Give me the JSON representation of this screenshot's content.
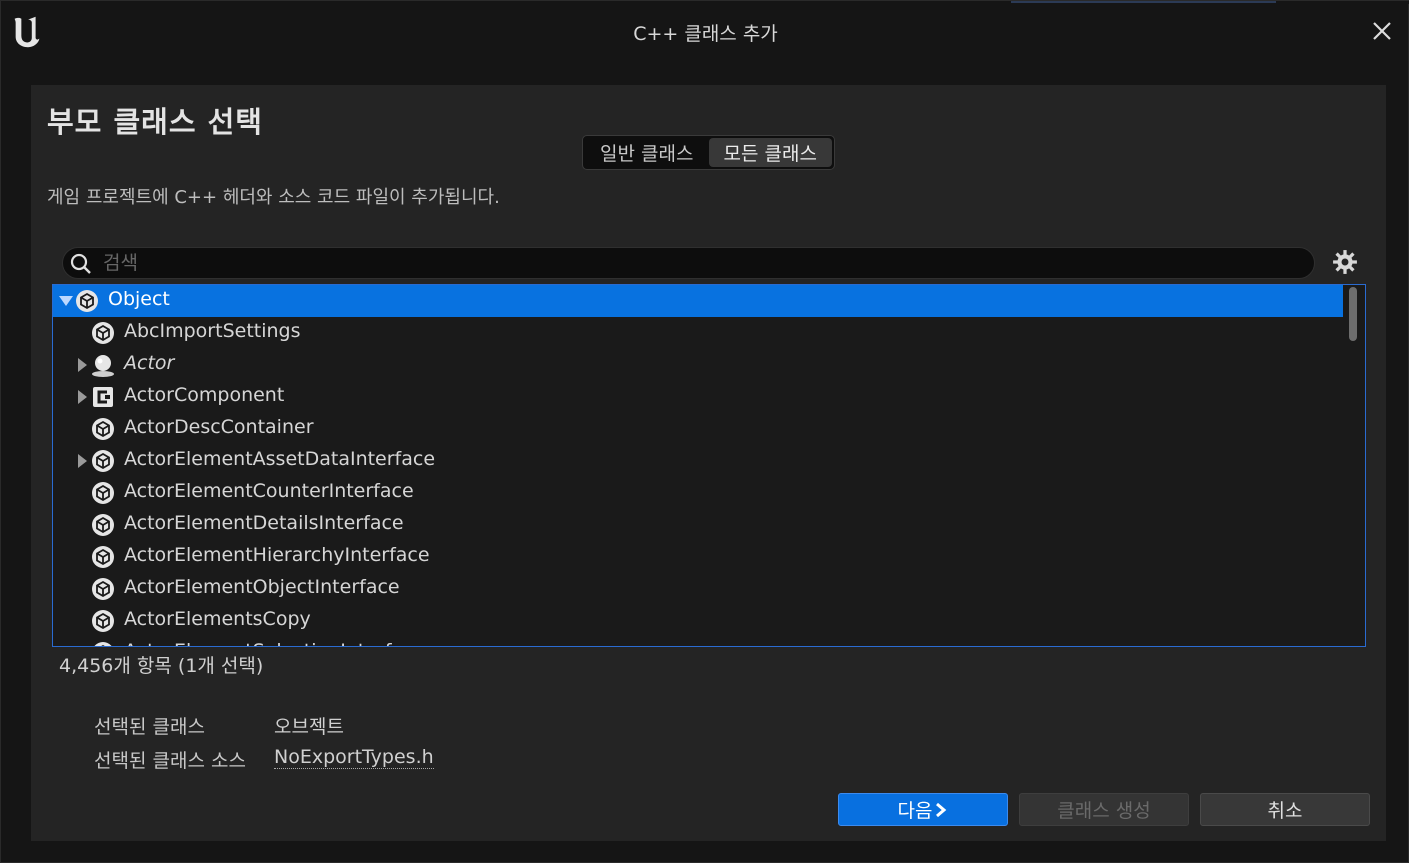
{
  "window": {
    "title": "C++ 클래스 추가"
  },
  "panel": {
    "heading": "부모 클래스 선택",
    "toggle": {
      "common": "일반 클래스",
      "all": "모든 클래스",
      "active": "all"
    },
    "description": "게임 프로젝트에 C++ 헤더와 소스 코드 파일이 추가됩니다."
  },
  "search": {
    "placeholder": "검색",
    "value": ""
  },
  "tree": {
    "items": [
      {
        "label": "Object",
        "icon": "object-icon",
        "expanded": true,
        "has_children": true,
        "selected": true,
        "indent": 0,
        "italic": false
      },
      {
        "label": "AbcImportSettings",
        "icon": "object-icon",
        "has_children": false,
        "selected": false,
        "indent": 1,
        "italic": false
      },
      {
        "label": "Actor",
        "icon": "actor-icon",
        "has_children": true,
        "selected": false,
        "indent": 1,
        "italic": true
      },
      {
        "label": "ActorComponent",
        "icon": "component-icon",
        "has_children": true,
        "selected": false,
        "indent": 1,
        "italic": false
      },
      {
        "label": "ActorDescContainer",
        "icon": "object-icon",
        "has_children": false,
        "selected": false,
        "indent": 1,
        "italic": false
      },
      {
        "label": "ActorElementAssetDataInterface",
        "icon": "object-icon",
        "has_children": true,
        "selected": false,
        "indent": 1,
        "italic": false
      },
      {
        "label": "ActorElementCounterInterface",
        "icon": "object-icon",
        "has_children": false,
        "selected": false,
        "indent": 1,
        "italic": false
      },
      {
        "label": "ActorElementDetailsInterface",
        "icon": "object-icon",
        "has_children": false,
        "selected": false,
        "indent": 1,
        "italic": false
      },
      {
        "label": "ActorElementHierarchyInterface",
        "icon": "object-icon",
        "has_children": false,
        "selected": false,
        "indent": 1,
        "italic": false
      },
      {
        "label": "ActorElementObjectInterface",
        "icon": "object-icon",
        "has_children": false,
        "selected": false,
        "indent": 1,
        "italic": false
      },
      {
        "label": "ActorElementsCopy",
        "icon": "object-icon",
        "has_children": false,
        "selected": false,
        "indent": 1,
        "italic": false
      },
      {
        "label": "ActorElementSelectionInterface",
        "icon": "object-icon",
        "has_children": true,
        "selected": false,
        "indent": 1,
        "italic": false
      }
    ]
  },
  "status": {
    "count_text": "4,456개 항목 (1개 선택)"
  },
  "selection": {
    "class_label": "선택된 클래스",
    "class_value": "오브젝트",
    "source_label": "선택된 클래스 소스",
    "source_value": "NoExportTypes.h"
  },
  "buttons": {
    "next": "다음",
    "create": "클래스 생성",
    "cancel": "취소"
  },
  "colors": {
    "accent": "#0872e0",
    "panel": "#242424",
    "background": "#151515"
  }
}
